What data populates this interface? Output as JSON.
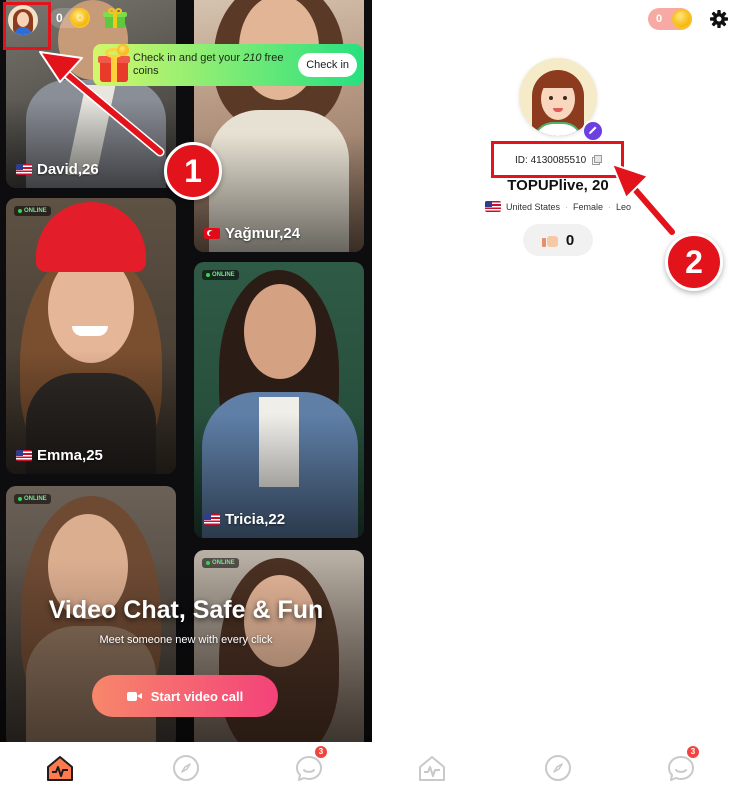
{
  "left_screen": {
    "coin_count": "0",
    "checkin_banner": {
      "text_before": "Check in and get your ",
      "text_amount": "210",
      "text_after": " free coins",
      "button_label": "Check in"
    },
    "profiles": [
      {
        "name": "David,26",
        "country": "us",
        "online": false
      },
      {
        "name": "Yağmur,24",
        "country": "tr",
        "online": false
      },
      {
        "name": "Emma,25",
        "country": "us",
        "online": true
      },
      {
        "name": "Tricia,22",
        "country": "us",
        "online": true
      },
      {
        "name": "",
        "country": "",
        "online": true
      },
      {
        "name": "",
        "country": "",
        "online": true
      }
    ],
    "online_label": "ONLINE",
    "promo_title": "Video Chat, Safe & Fun",
    "promo_subtitle": "Meet someone new with every click",
    "start_button_label": "Start video call",
    "messages_badge": "3"
  },
  "right_screen": {
    "coin_count": "0",
    "user_id": "ID: 4130085510",
    "display_name": "TOPUPlive, 20",
    "country": "United States",
    "gender": "Female",
    "zodiac": "Leo",
    "likes": "0",
    "messages_badge": "3"
  },
  "annotations": {
    "step1": "1",
    "step2": "2"
  },
  "colors": {
    "accent_red": "#e3131b",
    "start_gradient_from": "#f7876a",
    "start_gradient_to": "#f4427a",
    "checkin_from": "#d4f76b",
    "checkin_to": "#27e07f",
    "edit_badge": "#6b3fe0"
  }
}
